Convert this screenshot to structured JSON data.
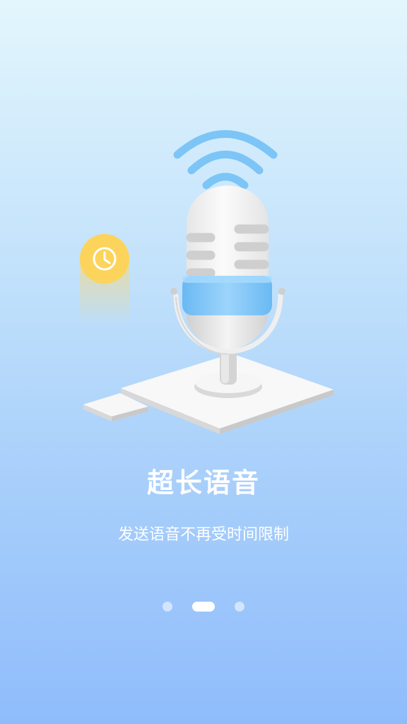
{
  "onboarding": {
    "title": "超长语音",
    "subtitle": "发送语音不再受时间限制",
    "page_indicator": {
      "total": 3,
      "current": 2
    }
  },
  "colors": {
    "background_top": "#e3f6fd",
    "background_bottom": "#8fbcfb",
    "signal": "#7cc5f6",
    "clock_badge": "#fcd45b"
  },
  "icons": [
    "wifi-signal-icon",
    "clock-icon",
    "microphone-icon"
  ]
}
